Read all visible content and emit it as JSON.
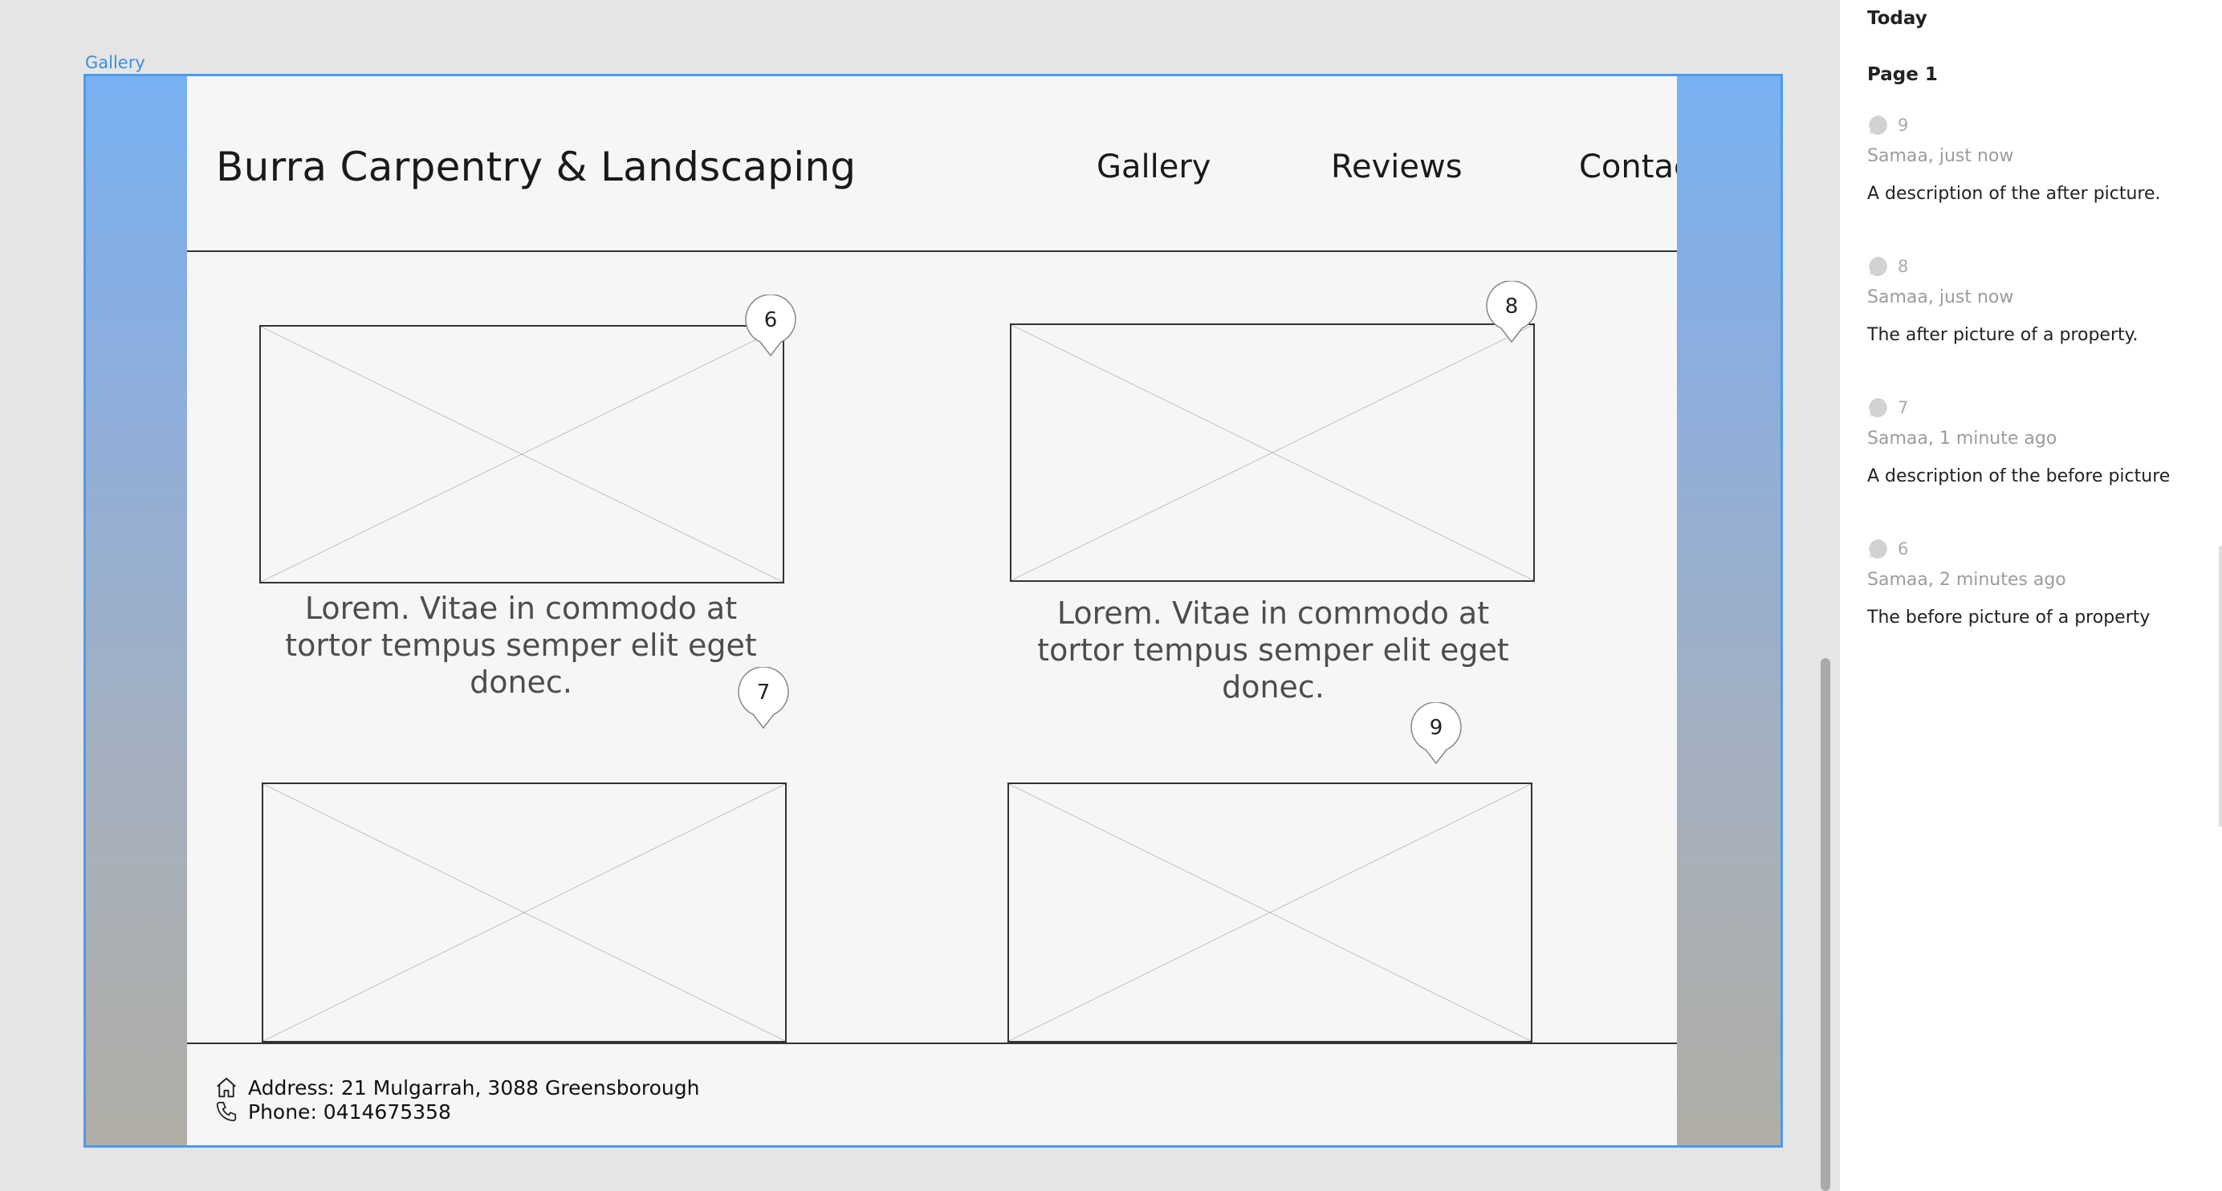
{
  "canvas": {
    "artboard_label": "Gallery"
  },
  "site": {
    "title": "Burra Carpentry & Landscaping",
    "nav": [
      "Gallery",
      "Reviews",
      "Contact"
    ],
    "captions": [
      "Lorem. Vitae in commodo at tortor tempus semper elit eget donec.",
      "Lorem. Vitae in commodo at tortor tempus semper elit eget donec."
    ],
    "pins": [
      "6",
      "7",
      "8",
      "9"
    ],
    "footer": {
      "address": "Address:  21 Mulgarrah, 3088 Greensborough",
      "phone": "Phone: 0414675358"
    }
  },
  "comments_panel": {
    "today": "Today",
    "page": "Page 1",
    "comments": [
      {
        "number": "9",
        "meta": "Samaa, just now",
        "text": "A description of the after picture."
      },
      {
        "number": "8",
        "meta": "Samaa, just now",
        "text": "The after picture of a property."
      },
      {
        "number": "7",
        "meta": "Samaa, 1 minute ago",
        "text": "A description of the before picture"
      },
      {
        "number": "6",
        "meta": "Samaa, 2 minutes ago",
        "text": "The before picture of a property"
      }
    ]
  },
  "colors": {
    "selection": "#4a9bec",
    "page_bg": "#f6f6f6",
    "canvas_bg": "#e5e5e5"
  },
  "icons": [
    "home-icon",
    "phone-icon",
    "comment-bubble-icon",
    "comment-pin-icon"
  ]
}
